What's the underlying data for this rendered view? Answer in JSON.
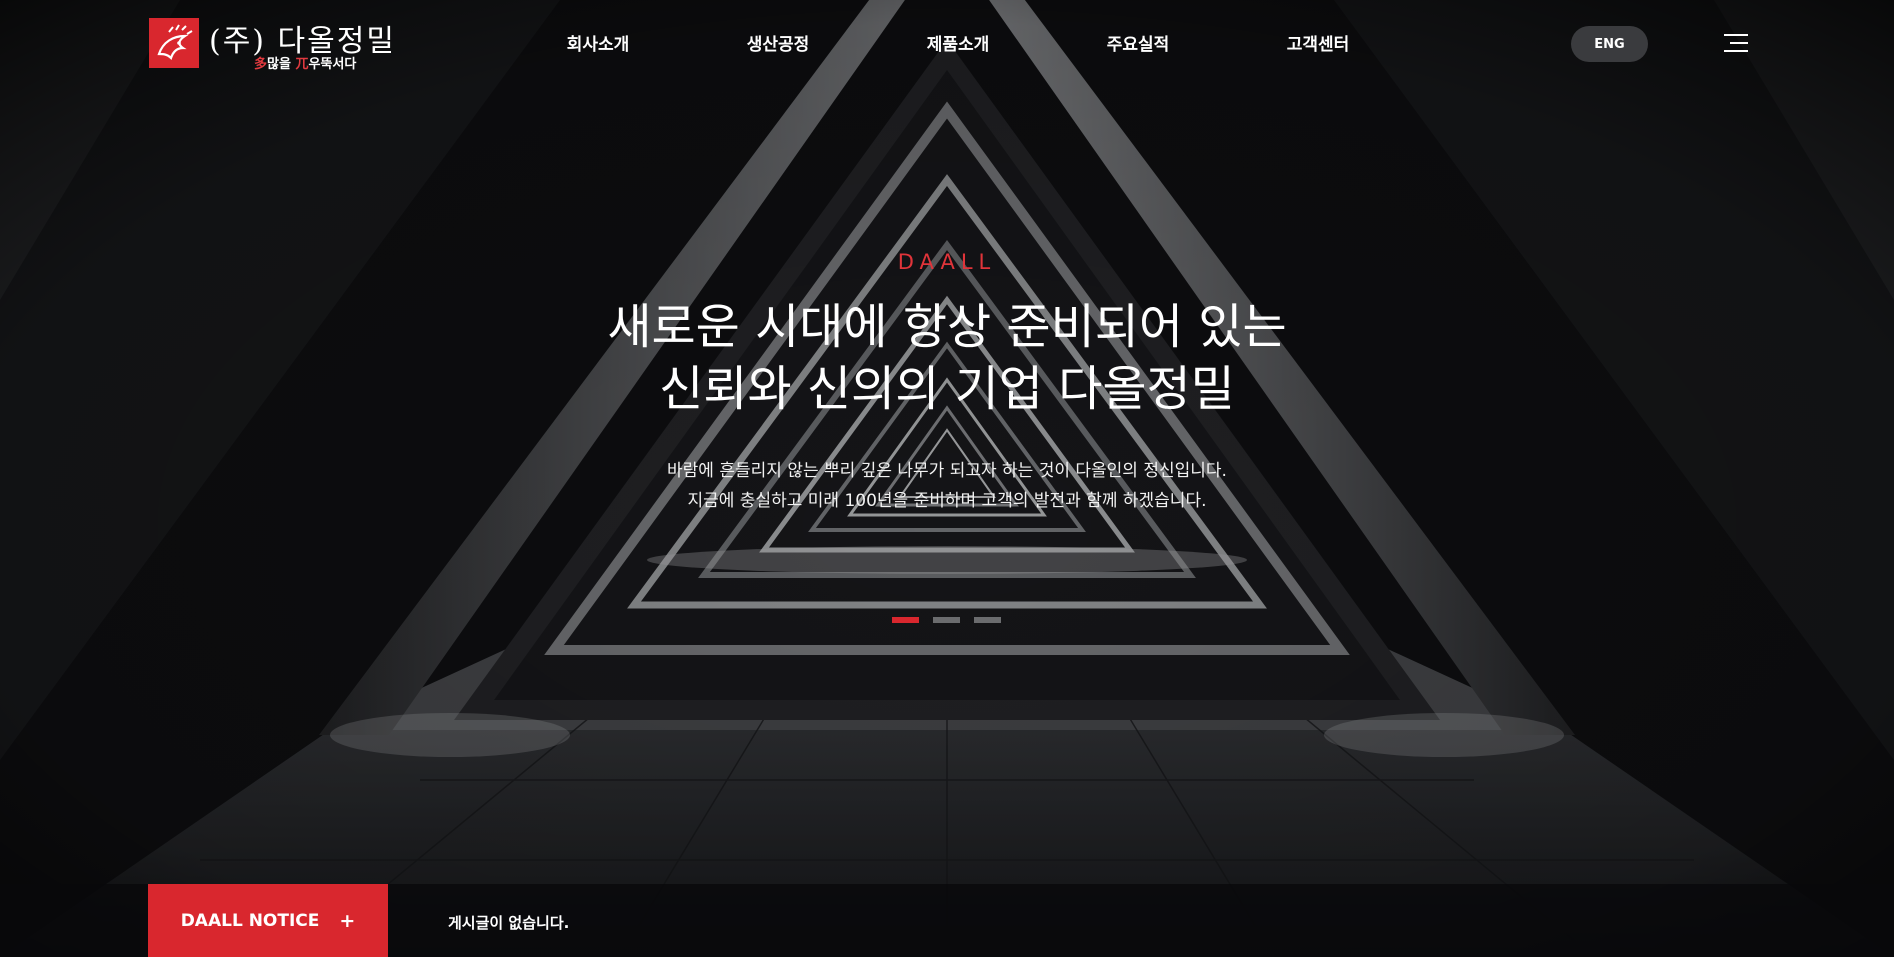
{
  "header": {
    "logo": {
      "name": "(주) 다올정밀",
      "slogan_red_1": "多",
      "slogan_part_1": "많을 ",
      "slogan_red_2": "兀",
      "slogan_part_2": "우뚝서다"
    },
    "nav": [
      {
        "label": "회사소개"
      },
      {
        "label": "생산공정"
      },
      {
        "label": "제품소개"
      },
      {
        "label": "주요실적"
      },
      {
        "label": "고객센터"
      }
    ],
    "lang_button": "ENG",
    "menu_icon": "hamburger-menu-icon"
  },
  "hero": {
    "eyebrow": "DAALL",
    "headline_line1": "새로운 시대에 항상 준비되어 있는",
    "headline_line2": "신뢰와 신의의 기업 다올정밀",
    "desc_line1": "바람에 흔들리지 않는 뿌리 깊은 나무가 되고자 하는 것이 다올인의 정신입니다.",
    "desc_line2": "지금에 충실하고 미래 100년을 준비하며 고객의 발전과 함께 하겠습니다.",
    "slides": {
      "count": 3,
      "active_index": 0
    }
  },
  "notice": {
    "button_label": "DAALL NOTICE",
    "button_icon": "+",
    "message": "게시글이 없습니다."
  },
  "colors": {
    "accent_red": "#d9272e",
    "lang_button_bg": "#3a3b3e",
    "pager_inactive": "#6b6c6e"
  }
}
